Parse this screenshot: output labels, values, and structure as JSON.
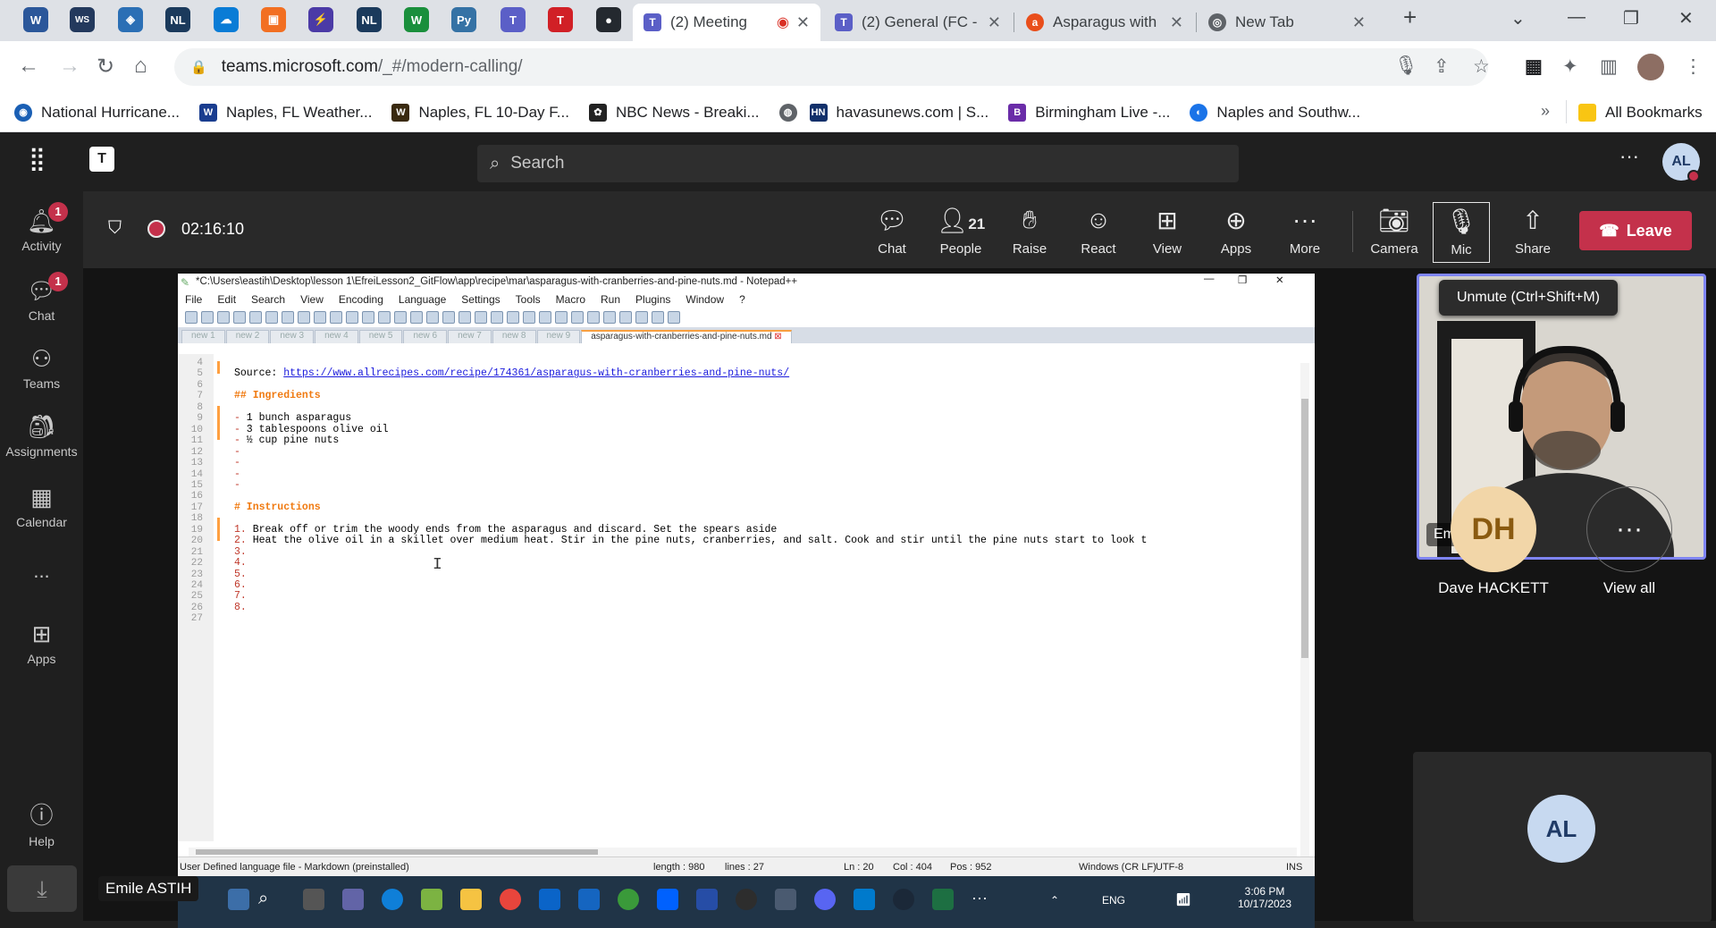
{
  "browser": {
    "tabs": [
      {
        "title": "(2) Meeting",
        "active": true,
        "recording": true
      },
      {
        "title": "(2) General (FC -",
        "active": false
      },
      {
        "title": "Asparagus with",
        "active": false
      },
      {
        "title": "New Tab",
        "active": false
      }
    ],
    "pinned_tabs": [
      "word-icon",
      "ws-icon",
      "shield-icon",
      "nl-icon",
      "onedrive-icon",
      "figma-icon",
      "lightning-icon",
      "nl-icon",
      "w-icon",
      "python-icon",
      "teams-icon",
      "t-icon",
      "github-icon"
    ],
    "url_domain": "teams.microsoft.com",
    "url_path": "/_#/modern-calling/",
    "bookmarks": [
      "National Hurricane...",
      "Naples, FL Weather...",
      "Naples, FL 10-Day F...",
      "NBC News - Breaki...",
      "",
      "havasunews.com | S...",
      "Birmingham Live -...",
      "Naples and Southw..."
    ],
    "all_bookmarks": "All Bookmarks"
  },
  "teams": {
    "search_placeholder": "Search",
    "avatar_initials": "AL",
    "rail": [
      {
        "label": "Activity",
        "badge": "1"
      },
      {
        "label": "Chat",
        "badge": "1"
      },
      {
        "label": "Teams"
      },
      {
        "label": "Assignments"
      },
      {
        "label": "Calendar"
      },
      {
        "label": "..."
      },
      {
        "label": "Apps"
      },
      {
        "label": "Help"
      }
    ],
    "call": {
      "timer": "02:16:10",
      "people_count": "21",
      "buttons": [
        "Chat",
        "People",
        "Raise",
        "React",
        "View",
        "Apps",
        "More",
        "Camera",
        "Mic",
        "Share"
      ],
      "leave": "Leave",
      "tooltip": "Unmute (Ctrl+Shift+M)"
    },
    "participants": {
      "speaker": "Emile ASTIH",
      "dh_initials": "DH",
      "dh_name": "Dave HACKETT",
      "view_all": "View all",
      "al_initials": "AL",
      "presenter_tag": "Emile ASTIH"
    }
  },
  "notepad": {
    "title": "*C:\\Users\\eastih\\Desktop\\lesson 1\\EfreiLesson2_GitFlow\\app\\recipe\\mar\\asparagus-with-cranberries-and-pine-nuts.md - Notepad++",
    "menu": [
      "File",
      "Edit",
      "Search",
      "View",
      "Encoding",
      "Language",
      "Settings",
      "Tools",
      "Macro",
      "Run",
      "Plugins",
      "Window",
      "?"
    ],
    "tabs": [
      "new 1",
      "new 2",
      "new 3",
      "new 4",
      "new 5",
      "new 6",
      "new 7",
      "new 8",
      "new 9",
      "asparagus-with-cranberries-and-pine-nuts.md"
    ],
    "lines": [
      {
        "n": "4",
        "text": ""
      },
      {
        "n": "5",
        "text": "Source: ",
        "link": "https://www.allrecipes.com/recipe/174361/asparagus-with-cranberries-and-pine-nuts/"
      },
      {
        "n": "6",
        "text": ""
      },
      {
        "n": "7",
        "text": "## Ingredients",
        "heading": true
      },
      {
        "n": "8",
        "text": ""
      },
      {
        "n": "9",
        "text": "- 1 bunch asparagus"
      },
      {
        "n": "10",
        "text": "- 3 tablespoons olive oil"
      },
      {
        "n": "11",
        "text": "- ½ cup pine nuts"
      },
      {
        "n": "12",
        "text": "-"
      },
      {
        "n": "13",
        "text": "-"
      },
      {
        "n": "14",
        "text": "-"
      },
      {
        "n": "15",
        "text": "-"
      },
      {
        "n": "16",
        "text": ""
      },
      {
        "n": "17",
        "text": "# Instructions",
        "heading": true
      },
      {
        "n": "18",
        "text": ""
      },
      {
        "n": "19",
        "text": "1. Break off or trim the woody ends from the asparagus and discard. Set the spears aside"
      },
      {
        "n": "20",
        "text": "2. Heat the olive oil in a skillet over medium heat. Stir in the pine nuts, cranberries, and salt. Cook and stir until the pine nuts start to look t"
      },
      {
        "n": "21",
        "text": "3."
      },
      {
        "n": "22",
        "text": "4."
      },
      {
        "n": "23",
        "text": "5."
      },
      {
        "n": "24",
        "text": "6."
      },
      {
        "n": "25",
        "text": "7."
      },
      {
        "n": "26",
        "text": "8."
      },
      {
        "n": "27",
        "text": ""
      }
    ],
    "status": {
      "lang": "User Defined language file - Markdown (preinstalled)",
      "length": "length : 980",
      "lines": "lines : 27",
      "ln": "Ln : 20",
      "col": "Col : 404",
      "pos": "Pos : 952",
      "eol": "Windows (CR LF)",
      "enc": "UTF-8",
      "ins": "INS"
    }
  },
  "taskbar": {
    "lang": "ENG",
    "time": "3:06 PM",
    "date": "10/17/2023"
  }
}
